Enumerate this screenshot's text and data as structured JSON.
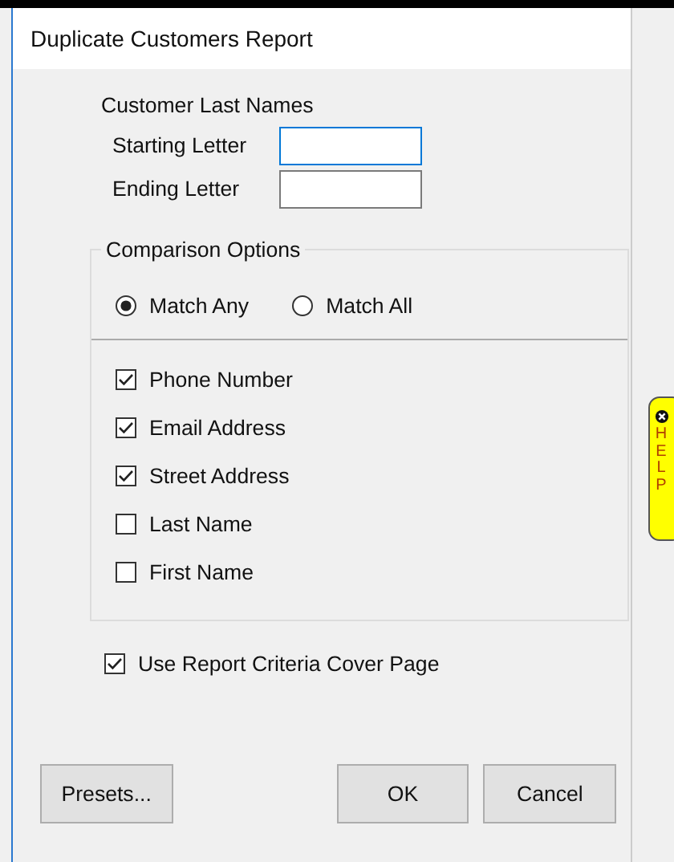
{
  "window": {
    "title": "Duplicate Customers Report"
  },
  "last_names": {
    "heading": "Customer Last Names",
    "fields": [
      {
        "label": "Starting Letter",
        "focused": true
      },
      {
        "label": "Ending Letter",
        "focused": false
      }
    ]
  },
  "comparison": {
    "title": "Comparison Options",
    "radios": [
      {
        "label": "Match Any",
        "selected": true
      },
      {
        "label": "Match All",
        "selected": false
      }
    ],
    "checks": [
      {
        "label": "Phone Number",
        "checked": true
      },
      {
        "label": "Email Address",
        "checked": true
      },
      {
        "label": "Street Address",
        "checked": true
      },
      {
        "label": "Last Name",
        "checked": false
      },
      {
        "label": "First Name",
        "checked": false
      }
    ]
  },
  "cover_page": {
    "label": "Use Report Criteria Cover Page",
    "checked": true
  },
  "help_tab": {
    "label": "HELP"
  },
  "buttons": [
    {
      "label": "Presets...",
      "kind": "left"
    },
    {
      "label": "OK",
      "kind": "right"
    },
    {
      "label": "Cancel",
      "kind": "right"
    }
  ]
}
